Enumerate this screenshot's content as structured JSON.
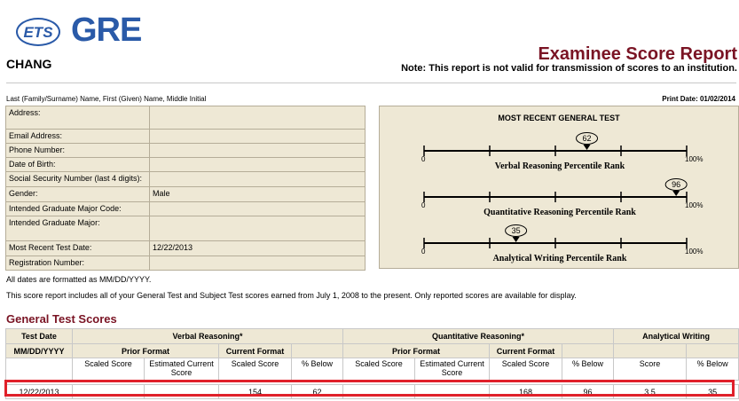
{
  "logo": {
    "ets": "ETS",
    "gre": "GRE"
  },
  "examinee_name": "CHANG",
  "report_title": "Examinee Score Report",
  "report_note": "Note: This report is not valid for transmission of scores to an institution.",
  "name_legend": "Last (Family/Surname) Name, First (Given) Name, Middle Initial",
  "print_date": "Print Date: 01/02/2014",
  "info_rows": [
    {
      "label": "Address:",
      "value": ""
    },
    {
      "label": "Email Address:",
      "value": ""
    },
    {
      "label": "Phone Number:",
      "value": ""
    },
    {
      "label": "Date of Birth:",
      "value": ""
    },
    {
      "label": "Social Security Number (last 4 digits):",
      "value": ""
    },
    {
      "label": "Gender:",
      "value": "Male"
    },
    {
      "label": "Intended Graduate Major Code:",
      "value": ""
    },
    {
      "label": "Intended Graduate Major:",
      "value": ""
    },
    {
      "label": "Most Recent Test Date:",
      "value": "12/22/2013"
    },
    {
      "label": "Registration Number:",
      "value": ""
    }
  ],
  "percentiles": {
    "title": "MOST RECENT GENERAL TEST",
    "scale_min_label": "0",
    "scale_max_label": "100%",
    "items": [
      {
        "label": "Verbal Reasoning Percentile Rank",
        "value": 62
      },
      {
        "label": "Quantitative Reasoning Percentile Rank",
        "value": 96
      },
      {
        "label": "Analytical Writing Percentile Rank",
        "value": 35
      }
    ]
  },
  "dates_note": "All dates are formatted as MM/DD/YYYY.",
  "report_scope": "This score report includes all of your General Test and Subject Test scores earned from July 1, 2008 to the present. Only reported scores are available for display.",
  "section_title": "General Test Scores",
  "scores": {
    "test_date": "Test Date",
    "date_format": "MM/DD/YYYY",
    "verbal": "Verbal Reasoning*",
    "quant": "Quantitative Reasoning*",
    "writing": "Analytical Writing",
    "prior_format": "Prior Format",
    "current_format": "Current Format",
    "scaled_score": "Scaled Score",
    "estimated_current_score": "Estimated Current Score",
    "percent_below": "% Below",
    "score": "Score",
    "row": {
      "date": "12/22/2013",
      "verbal_prior_scaled": "",
      "verbal_prior_estimated": "",
      "verbal_current_scaled": "154",
      "verbal_current_below": "62",
      "quant_prior_scaled": "",
      "quant_prior_estimated": "",
      "quant_current_scaled": "168",
      "quant_current_below": "96",
      "writing_score": "3.5",
      "writing_below": "35"
    }
  }
}
